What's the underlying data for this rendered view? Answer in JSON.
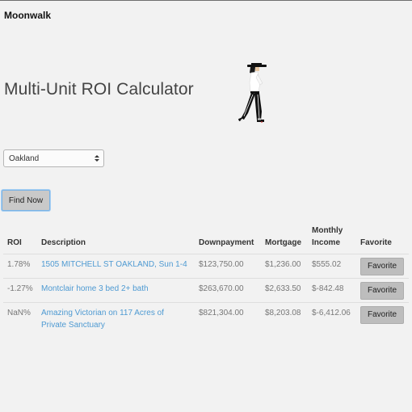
{
  "brand": "Moonwalk",
  "page": {
    "title": "Multi-Unit ROI Calculator"
  },
  "city_select": {
    "selected": "Oakland"
  },
  "find_button": {
    "label": "Find Now"
  },
  "table": {
    "headers": {
      "roi": "ROI",
      "description": "Description",
      "downpayment": "Downpayment",
      "mortgage": "Mortgage",
      "monthly_income": "Monthly Income",
      "favorite": "Favorite"
    },
    "rows": [
      {
        "roi": "1.78%",
        "description": "1505 MITCHELL ST OAKLAND, Sun 1-4",
        "downpayment": "$123,750.00",
        "mortgage": "$1,236.00",
        "monthly_income": "$555.02",
        "favorite_label": "Favorite"
      },
      {
        "roi": "-1.27%",
        "description": "Montclair home 3 bed 2+ bath",
        "downpayment": "$263,670.00",
        "mortgage": "$2,633.50",
        "monthly_income": "$-842.48",
        "favorite_label": "Favorite"
      },
      {
        "roi": "NaN%",
        "description": "Amazing Victorian on 117 Acres of Private Sanctuary",
        "downpayment": "$821,304.00",
        "mortgage": "$8,203.08",
        "monthly_income": "$-6,412.06",
        "favorite_label": "Favorite"
      }
    ]
  },
  "colors": {
    "link": "#4e9ad2",
    "button_focus_border": "#79b3e6",
    "background": "#f2f2f2"
  },
  "icons": {
    "mascot": "moonwalker-dancer-figure"
  }
}
